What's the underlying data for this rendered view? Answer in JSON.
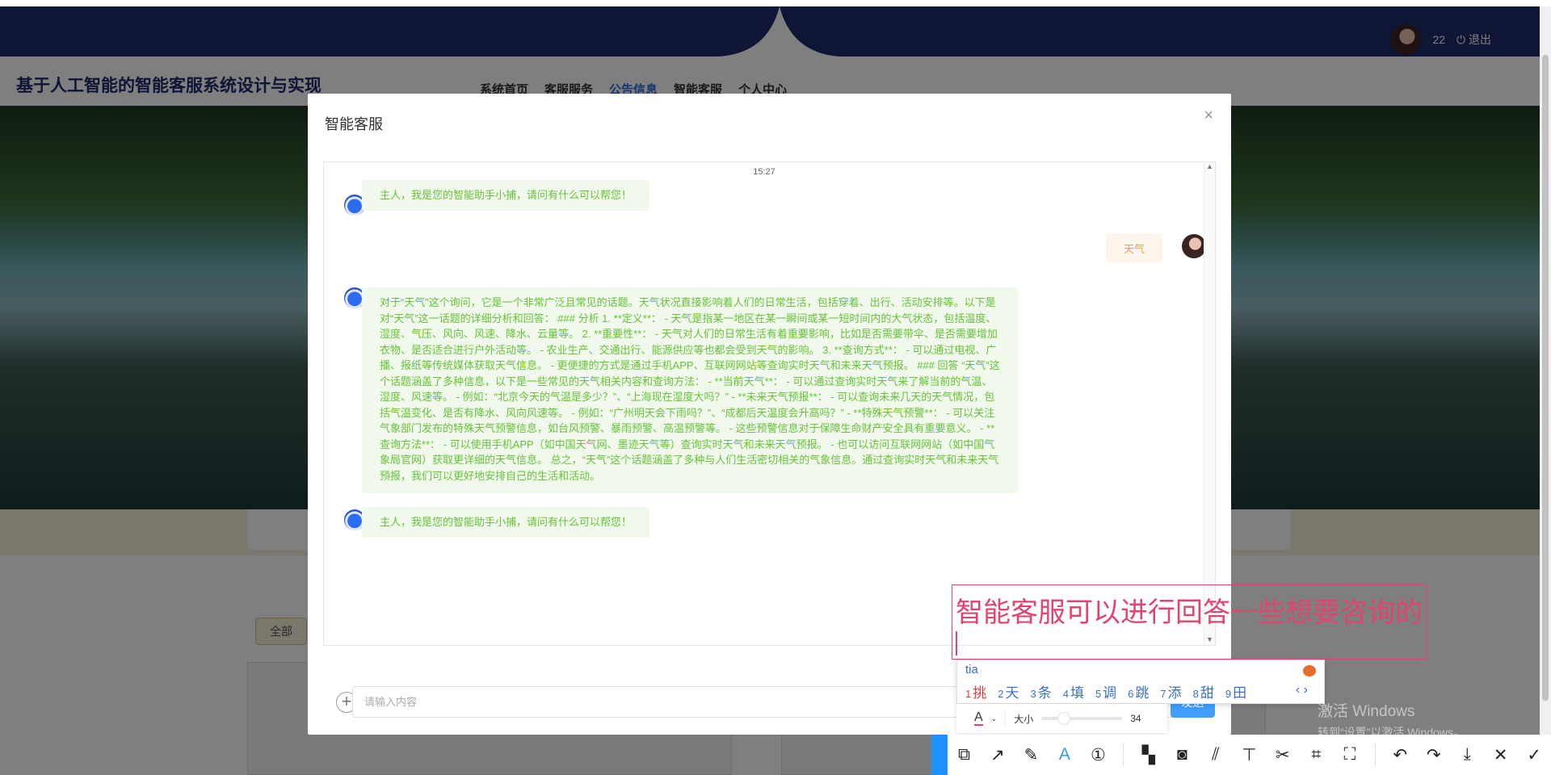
{
  "header": {
    "user_name": "22",
    "logout_label": "退出",
    "site_title": "基于人工智能的智能客服系统设计与实现",
    "nav": [
      {
        "label": "系统首页"
      },
      {
        "label": "客服服务"
      },
      {
        "label": "公告信息",
        "active": true
      },
      {
        "label": "智能客服"
      },
      {
        "label": "个人中心"
      }
    ]
  },
  "filter": {
    "all_label": "全部"
  },
  "modal": {
    "title": "智能客服",
    "close_label": "×",
    "timestamp": "15:27",
    "messages": [
      {
        "role": "bot",
        "text": "主人，我是您的智能助手小捕，请问有什么可以帮您！"
      },
      {
        "role": "user",
        "text": "天气"
      },
      {
        "role": "bot",
        "text": "对于“天气”这个询问，它是一个非常广泛且常见的话题。天气状况直接影响着人们的日常生活，包括穿着、出行、活动安排等。以下是对“天气”这一话题的详细分析和回答： ### 分析 1. **定义**： - 天气是指某一地区在某一瞬间或某一短时间内的大气状态，包括温度、湿度、气压、风向、风速、降水、云量等。 2. **重要性**： - 天气对人们的日常生活有着重要影响，比如是否需要带伞、是否需要增加衣物、是否适合进行户外活动等。 - 农业生产、交通出行、能源供应等也都会受到天气的影响。 3. **查询方式**： - 可以通过电视、广播、报纸等传统媒体获取天气信息。 - 更便捷的方式是通过手机APP、互联网网站等查询实时天气和未来天气预报。 ### 回答 “天气”这个话题涵盖了多种信息，以下是一些常见的天气相关内容和查询方法： - **当前天气**： - 可以通过查询实时天气来了解当前的气温、湿度、风速等。 - 例如：“北京今天的气温是多少？”、“上海现在湿度大吗？” - **未来天气预报**： - 可以查询未来几天的天气情况，包括气温变化、是否有降水、风向风速等。 - 例如：“广州明天会下雨吗？”、“成都后天温度会升高吗？” - **特殊天气预警**： - 可以关注气象部门发布的特殊天气预警信息，如台风预警、暴雨预警、高温预警等。 - 这些预警信息对于保障生命财产安全具有重要意义。 - **查询方法**： - 可以使用手机APP（如中国天气网、墨迹天气等）查询实时天气和未来天气预报。 - 也可以访问互联网网站（如中国气象局官网）获取更详细的天气信息。 总之，“天气”这个话题涵盖了多种与人们生活密切相关的气象信息。通过查询实时天气和未来天气预报，我们可以更好地安排自己的生活和活动。"
      },
      {
        "role": "bot",
        "text": "主人，我是您的智能助手小捕，请问有什么可以帮您！"
      }
    ],
    "input_placeholder": "请输入内容",
    "send_label": "发送"
  },
  "annotation": {
    "text": "智能客服可以进行回答一些想要咨询的",
    "color": "#e0456f",
    "size_label": "大小",
    "size_value": "34"
  },
  "ime": {
    "code": "tia",
    "candidates": [
      {
        "n": "1",
        "c": "挑"
      },
      {
        "n": "2",
        "c": "天"
      },
      {
        "n": "3",
        "c": "条"
      },
      {
        "n": "4",
        "c": "填"
      },
      {
        "n": "5",
        "c": "调"
      },
      {
        "n": "6",
        "c": "跳"
      },
      {
        "n": "7",
        "c": "添"
      },
      {
        "n": "8",
        "c": "甜"
      },
      {
        "n": "9",
        "c": "田"
      }
    ]
  },
  "watermark": {
    "line1": "激活 Windows",
    "line2": "转到“设置”以激活 Windows。"
  },
  "toolbar": {
    "tools": [
      "shape-icon",
      "arrow-icon",
      "pen-icon",
      "text-icon",
      "number-icon",
      "mosaic-icon",
      "blur-icon",
      "hatch-icon",
      "pin-icon",
      "cut-icon",
      "ocr-icon",
      "text-recognize-icon",
      "undo-icon",
      "redo-icon",
      "download-icon",
      "close-icon",
      "confirm-icon"
    ]
  },
  "colors": {
    "navy": "#1c2a6b",
    "accent": "#409eff",
    "bot_bubble": "#f0f9eb",
    "bot_text": "#67c23a",
    "user_bubble": "#fdf6ec",
    "user_text": "#e6a23c"
  }
}
